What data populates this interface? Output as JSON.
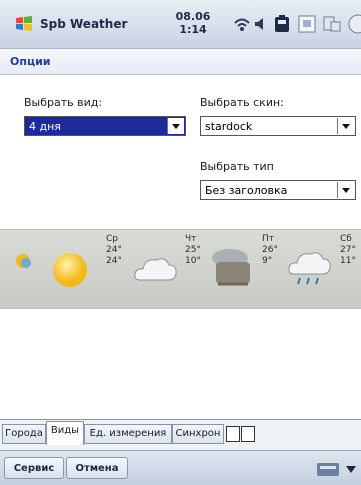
{
  "statusbar": {
    "app_title": "Spb Weather",
    "clock_date": "08.06",
    "clock_time": "1:14"
  },
  "header": {
    "title": "Опции"
  },
  "options": {
    "view_label": "Выбрать вид:",
    "view_value": "4 дня",
    "skin_label": "Выбрать скин:",
    "skin_value": "stardock",
    "type_label": "Выбрать тип",
    "type_value": "Без заголовка"
  },
  "forecast": [
    {
      "day": "Ср",
      "high": "24°",
      "low": "24°",
      "icon": "sunny-icon"
    },
    {
      "day": "Чт",
      "high": "25°",
      "low": "10°",
      "icon": "cloudy-icon"
    },
    {
      "day": "Пт",
      "high": "26°",
      "low": "9°",
      "icon": "overcast-icon"
    },
    {
      "day": "Сб",
      "high": "27°",
      "low": "11°",
      "icon": "rain-icon"
    }
  ],
  "tabs": [
    "Города",
    "Виды",
    "Ед. измерения",
    "Синхрон"
  ],
  "active_tab": "Виды",
  "softkeys": {
    "left": "Сервис",
    "right": "Отмена"
  },
  "colors": {
    "accent": "#1c2a9e",
    "header_text": "#1c3fa0",
    "sun": "#f2b91b"
  }
}
